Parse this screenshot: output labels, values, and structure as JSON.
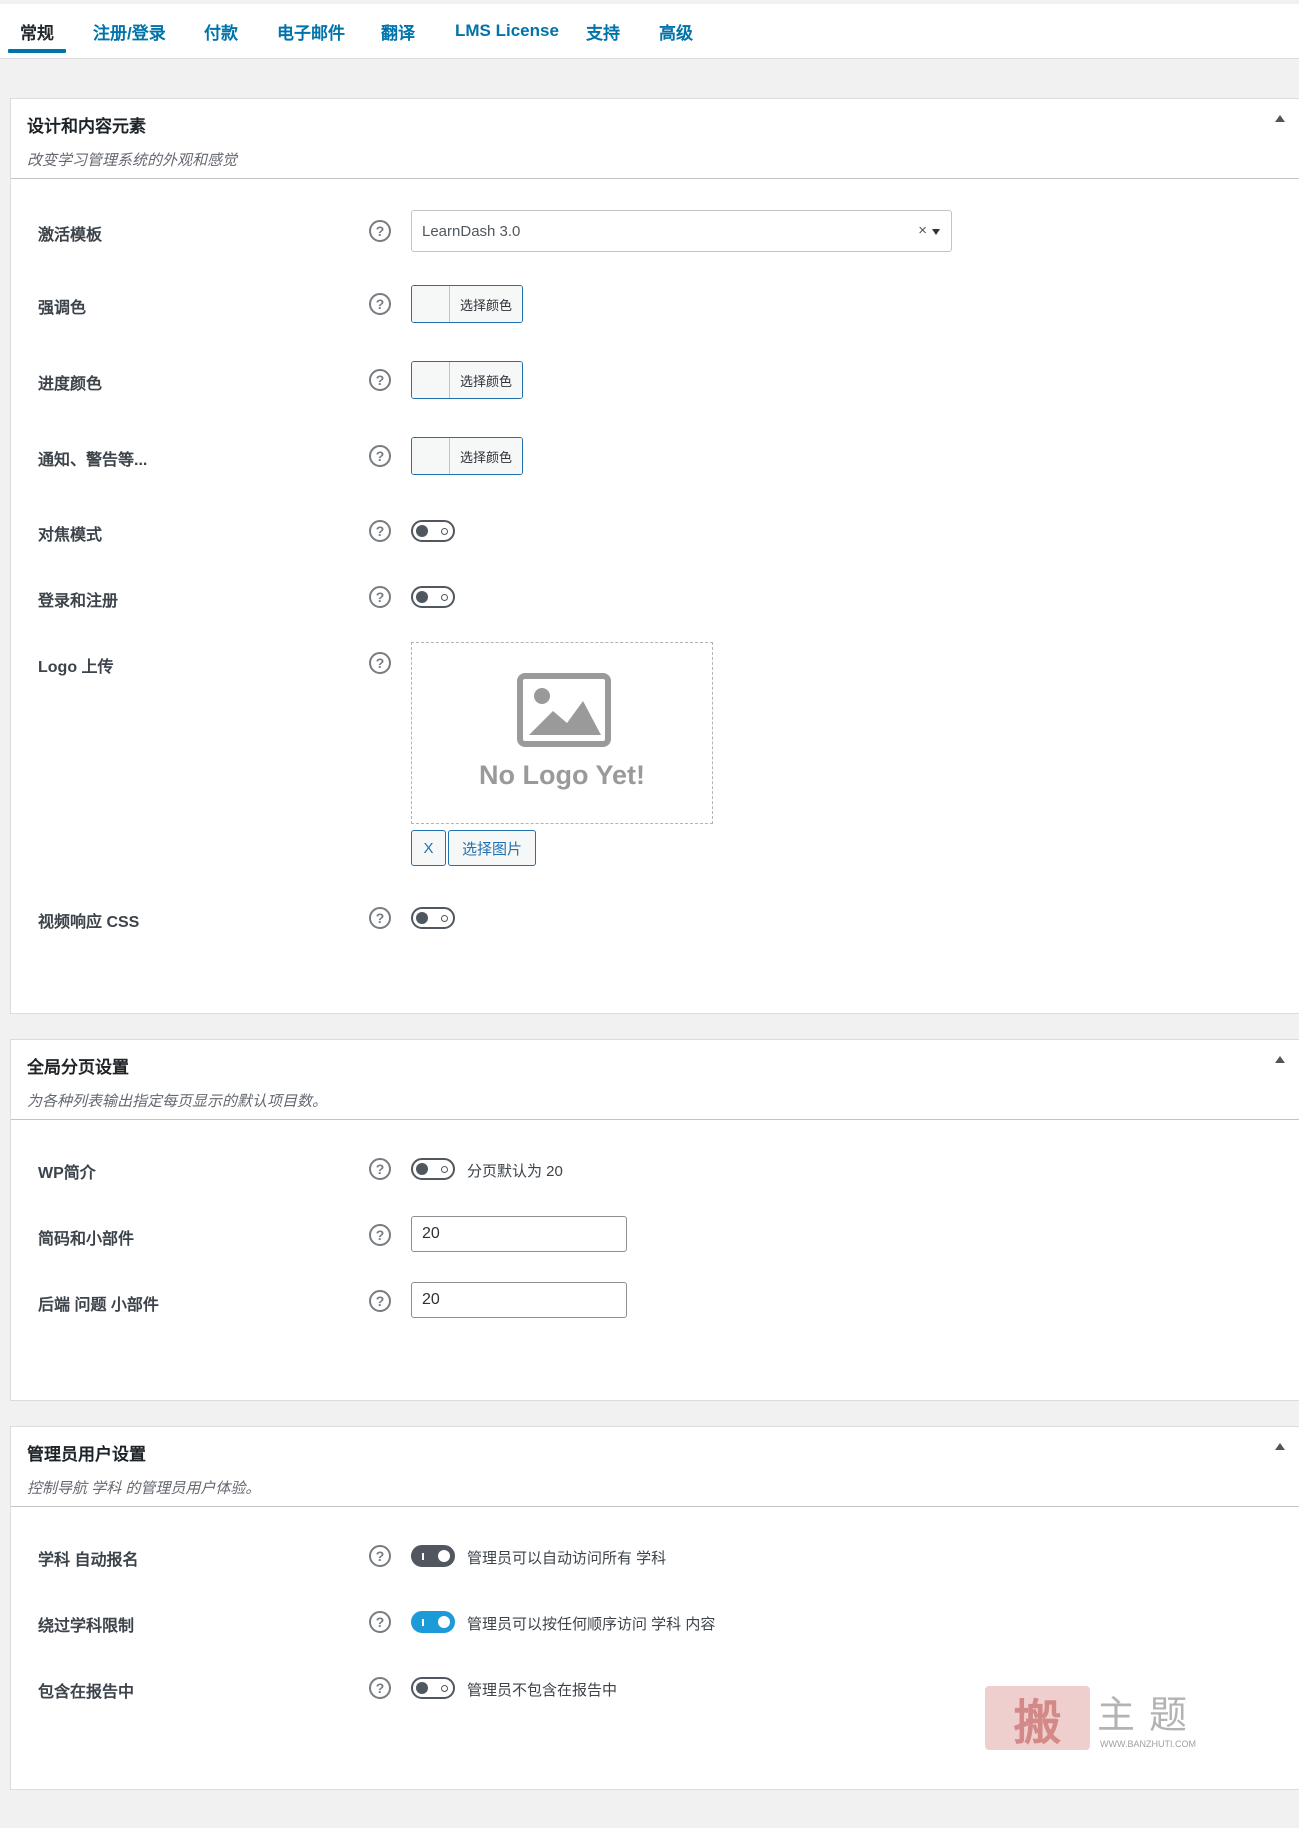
{
  "tabs": [
    "常规",
    "注册/登录",
    "付款",
    "电子邮件",
    "翻译",
    "LMS License",
    "支持",
    "高级"
  ],
  "design_panel": {
    "title": "设计和内容元素",
    "description": "改变学习管理系统的外观和感觉",
    "active_template_label": "激活模板",
    "active_template_value": "LearnDash 3.0",
    "accent_color_label": "强调色",
    "progress_color_label": "进度颜色",
    "alerts_color_label": "通知、警告等...",
    "color_picker_label": "选择颜色",
    "focus_mode_label": "对焦模式",
    "login_registration_label": "登录和注册",
    "logo_upload_label": "Logo 上传",
    "no_logo_text": "No Logo Yet!",
    "remove_image_label": "X",
    "select_image_label": "选择图片",
    "responsive_video_label": "视频响应 CSS"
  },
  "pagination_panel": {
    "title": "全局分页设置",
    "description": "为各种列表输出指定每页显示的默认项目数。",
    "wp_profile_label": "WP简介",
    "wp_profile_note": "分页默认为 20",
    "shortcodes_label": "简码和小部件",
    "shortcodes_value": "20",
    "backend_questions_label": "后端 问题 小部件",
    "backend_questions_value": "20"
  },
  "admin_panel": {
    "title": "管理员用户设置",
    "description": "控制导航 学科 的管理员用户体验。",
    "auto_enroll_label": "学科 自动报名",
    "auto_enroll_note": "管理员可以自动访问所有 学科",
    "bypass_label": "绕过学科限制",
    "bypass_note": "管理员可以按任何顺序访问 学科 内容",
    "reports_label": "包含在报告中",
    "reports_note": "管理员不包含在报告中"
  },
  "watermark": {
    "stamp": "搬",
    "text": "主题",
    "url": "WWW.BANZHUTI.COM"
  },
  "colors": {
    "link_blue": "#0073aa",
    "toggle_blue": "#1d9bd8",
    "toggle_dark": "#50575e"
  }
}
